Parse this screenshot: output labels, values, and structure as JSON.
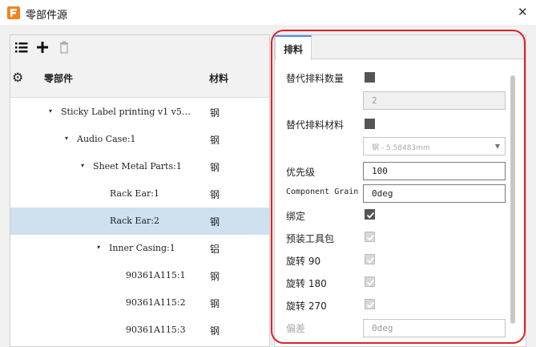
{
  "window": {
    "title": "零部件源",
    "close_glyph": "✕"
  },
  "toolbar": {
    "list_icon": "list-icon",
    "add_icon": "add-icon",
    "delete_icon": "trash-icon"
  },
  "tree_header": {
    "part": "零部件",
    "material": "材料"
  },
  "tree": [
    {
      "name": "Sticky Label printing v1 v5…",
      "material": "钢",
      "caret": "▾",
      "selected": false
    },
    {
      "name": "Audio Case:1",
      "material": "钢",
      "caret": "▾",
      "selected": false
    },
    {
      "name": "Sheet Metal Parts:1",
      "material": "钢",
      "caret": "▾",
      "selected": false
    },
    {
      "name": "Rack Ear:1",
      "material": "钢",
      "caret": "",
      "selected": false
    },
    {
      "name": "Rack Ear:2",
      "material": "钢",
      "caret": "",
      "selected": true
    },
    {
      "name": "Inner Casing:1",
      "material": "铝",
      "caret": "▾",
      "selected": false
    },
    {
      "name": "90361A115:1",
      "material": "钢",
      "caret": "",
      "selected": false
    },
    {
      "name": "90361A115:2",
      "material": "钢",
      "caret": "",
      "selected": false
    },
    {
      "name": "90361A115:3",
      "material": "钢",
      "caret": "",
      "selected": false
    }
  ],
  "panel": {
    "tab": "排料",
    "alt_qty_label": "替代排料数量",
    "alt_qty_value": "2",
    "alt_mat_label": "替代排料材料",
    "alt_mat_value": "钢 - 5.58483mm",
    "priority_label": "优先级",
    "priority_value": "100",
    "grain_label": "Component Grain",
    "grain_value": "0deg",
    "bind_label": "绑定",
    "preinstall_label": "预装工具包",
    "rot90_label": "旋转 90",
    "rot180_label": "旋转 180",
    "rot270_label": "旋转 270",
    "offset_label": "偏差",
    "offset_value": "0deg"
  },
  "colors": {
    "accent": "#4a90e2",
    "selection": "#cfe1ee",
    "highlight": "#e0202a",
    "app_icon": "#f5821f"
  }
}
